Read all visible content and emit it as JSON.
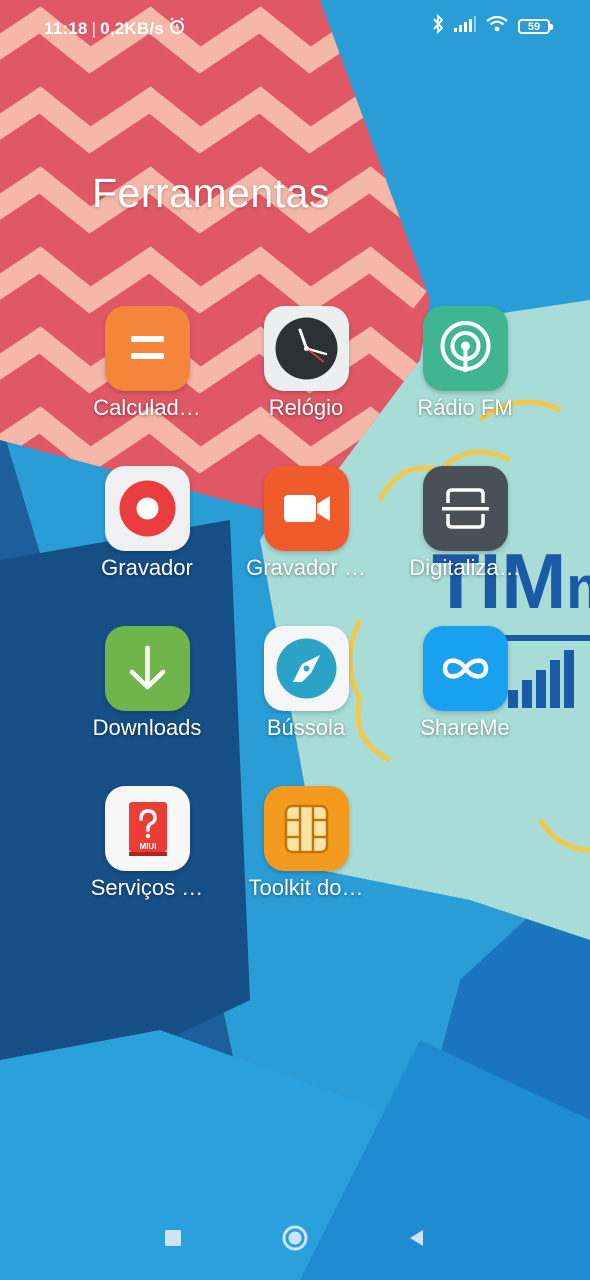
{
  "status_bar": {
    "time": "11:18",
    "separator": "|",
    "speed": "0,2KB/s",
    "battery": "59"
  },
  "folder": {
    "title": "Ferramentas",
    "apps": [
      {
        "label": "Calculad…",
        "icon": "calculator-icon"
      },
      {
        "label": "Relógio",
        "icon": "clock-icon"
      },
      {
        "label": "Rádio FM",
        "icon": "radio-icon"
      },
      {
        "label": "Gravador",
        "icon": "recorder-icon"
      },
      {
        "label": "Gravador …",
        "icon": "screen-recorder-icon"
      },
      {
        "label": "Digitaliza…",
        "icon": "scanner-icon"
      },
      {
        "label": "Downloads",
        "icon": "download-icon"
      },
      {
        "label": "Bússola",
        "icon": "compass-icon"
      },
      {
        "label": "ShareMe",
        "icon": "shareme-icon"
      },
      {
        "label": "Serviços …",
        "icon": "miui-services-icon"
      },
      {
        "label": "Toolkit do…",
        "icon": "sim-toolkit-icon"
      }
    ]
  },
  "wallpaper_text": {
    "brand": "TIM",
    "brand_suffix": "m"
  },
  "colors": {
    "calculator": "#f5853a",
    "radio": "#3fb592",
    "screen_recorder": "#ef5b2b",
    "scanner": "#4a5058",
    "downloads": "#6fb54b",
    "shareme": "#1aa0f0",
    "sim_toolkit": "#f39a1f",
    "miui_red": "#ea3d36"
  },
  "nav": {
    "recents": "recents-icon",
    "home": "home-icon",
    "back": "back-icon"
  }
}
